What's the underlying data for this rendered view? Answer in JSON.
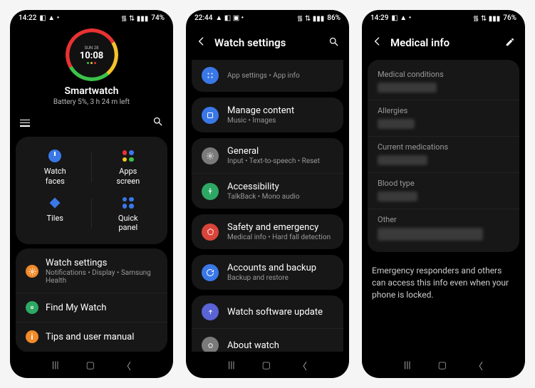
{
  "screen1": {
    "status": {
      "time": "14:22",
      "battery": "74%"
    },
    "watchface": {
      "day": "SUN 28",
      "time": "10:08"
    },
    "device_name": "Smartwatch",
    "battery_line": "Battery 5%, 3 h 24 m left",
    "grid": {
      "watch_faces": "Watch\nfaces",
      "apps_screen": "Apps\nscreen",
      "tiles": "Tiles",
      "quick_panel": "Quick\npanel"
    },
    "list": {
      "watch_settings": {
        "title": "Watch settings",
        "sub": "Notifications • Display • Samsung Health"
      },
      "find_my_watch": {
        "title": "Find My Watch"
      },
      "tips": {
        "title": "Tips and user manual"
      }
    }
  },
  "screen2": {
    "status": {
      "time": "22:44",
      "battery": "86%"
    },
    "header": "Watch settings",
    "items": {
      "apps_sub": "App settings • App info",
      "manage_content": {
        "title": "Manage content",
        "sub": "Music • Images"
      },
      "general": {
        "title": "General",
        "sub": "Input • Text-to-speech • Reset"
      },
      "accessibility": {
        "title": "Accessibility",
        "sub": "TalkBack • Mono audio"
      },
      "safety": {
        "title": "Safety and emergency",
        "sub": "Medical info • Hard fall detection"
      },
      "accounts": {
        "title": "Accounts and backup",
        "sub": "Backup and restore"
      },
      "update": {
        "title": "Watch software update"
      },
      "about": {
        "title": "About watch"
      }
    }
  },
  "screen3": {
    "status": {
      "time": "14:29",
      "battery": "76%"
    },
    "header": "Medical info",
    "labels": {
      "conditions": "Medical conditions",
      "allergies": "Allergies",
      "medications": "Current medications",
      "blood_type": "Blood type",
      "other": "Other"
    },
    "info_text": "Emergency responders and others can access this info even when your phone is locked."
  },
  "colors": {
    "blue": "#3a78e8",
    "green": "#2ea865",
    "orange": "#f08a2b",
    "red": "#d9453a",
    "indigo": "#5a64d4",
    "teal": "#2b9a9a",
    "grey": "#7a7a7a"
  }
}
